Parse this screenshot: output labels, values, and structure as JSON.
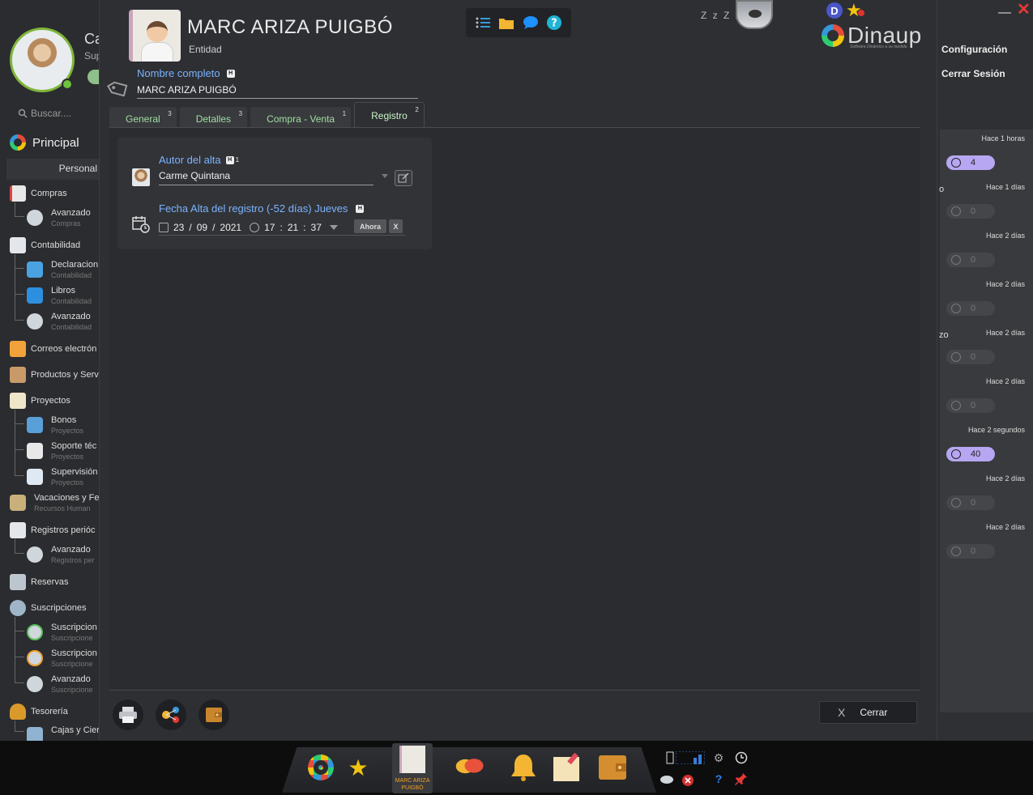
{
  "sidebar": {
    "user_name": "Ca",
    "user_role": "Sup",
    "search_placeholder": "Buscar....",
    "principal_label": "Principal",
    "personal_tab": "Personal",
    "items": [
      {
        "label": "Compras"
      },
      {
        "label": "Avanzado",
        "sub": "Compras"
      },
      {
        "label": "Contabilidad"
      },
      {
        "label": "Declaracion",
        "sub": "Contabilidad"
      },
      {
        "label": "Libros",
        "sub": "Contabilidad"
      },
      {
        "label": "Avanzado",
        "sub": "Contabilidad"
      },
      {
        "label": "Correos electrón"
      },
      {
        "label": "Productos y Serv"
      },
      {
        "label": "Proyectos"
      },
      {
        "label": "Bonos",
        "sub": "Proyectos"
      },
      {
        "label": "Soporte téc",
        "sub": "Proyectos"
      },
      {
        "label": "Supervisión",
        "sub": "Proyectos"
      },
      {
        "label": "Vacaciones y Fe",
        "sub": "Recursos Human"
      },
      {
        "label": "Registros perióc"
      },
      {
        "label": "Avanzado",
        "sub": "Registros per"
      },
      {
        "label": "Reservas"
      },
      {
        "label": "Suscripciones"
      },
      {
        "label": "Suscripcion",
        "sub": "Suscripcione"
      },
      {
        "label": "Suscripcion",
        "sub": "Suscripcione"
      },
      {
        "label": "Avanzado",
        "sub": "Suscripcione"
      },
      {
        "label": "Tesorería"
      },
      {
        "label": "Cajas y Cier"
      }
    ]
  },
  "right_panel": {
    "config_label": "Configuración",
    "logout_label": "Cerrar Sesión",
    "edge_labels": [
      "o",
      "zo"
    ],
    "notifications": [
      {
        "time": "Hace 1 horas",
        "count": "4",
        "active": true
      },
      {
        "time": "Hace 1 días",
        "count": "0",
        "active": false
      },
      {
        "time": "Hace 2 días",
        "count": "0",
        "active": false
      },
      {
        "time": "Hace 2 días",
        "count": "0",
        "active": false
      },
      {
        "time": "Hace 2 días",
        "count": "0",
        "active": false
      },
      {
        "time": "Hace 2 días",
        "count": "0",
        "active": false
      },
      {
        "time": "Hace 2 segundos",
        "count": "40",
        "active": true
      },
      {
        "time": "Hace 2 días",
        "count": "0",
        "active": false
      },
      {
        "time": "Hace 2 días",
        "count": "0",
        "active": false
      }
    ]
  },
  "header": {
    "title": "MARC ARIZA PUIGBÓ",
    "subtitle": "Entidad",
    "zzz": "Z z Z z",
    "logo_text": "Dinaup",
    "logo_tagline": "Software Dinámico a su medida",
    "d_badge": "D"
  },
  "form": {
    "nombre_label": "Nombre completo",
    "nombre_value": "MARC ARIZA PUIGBÓ",
    "h_badge": "H"
  },
  "tabs": [
    {
      "label": "General",
      "count": "3",
      "active": false
    },
    {
      "label": "Detalles",
      "count": "3",
      "active": false
    },
    {
      "label": "Compra - Venta",
      "count": "1",
      "active": false
    },
    {
      "label": "Registro",
      "count": "2",
      "active": true
    }
  ],
  "registro": {
    "autor_label": "Autor del alta",
    "autor_sup": "1",
    "autor_value": "Carme Quintana",
    "fecha_label": "Fecha Alta del registro (-52 días) Jueves",
    "date_day": "23",
    "date_month": "09",
    "date_year": "2021",
    "time_h": "17",
    "time_m": "21",
    "time_s": "37",
    "ahora_label": "Ahora",
    "clear_label": "X"
  },
  "footer": {
    "cerrar_label": "Cerrar",
    "cerrar_icon": "X"
  },
  "taskbar": {
    "entity_caption": "MARC ARIZA PUIGBÓ"
  },
  "colors": {
    "accent_blue": "#7ab3ff",
    "tab_green": "#9fdfa0",
    "pill_active": "#b7a7f2"
  }
}
